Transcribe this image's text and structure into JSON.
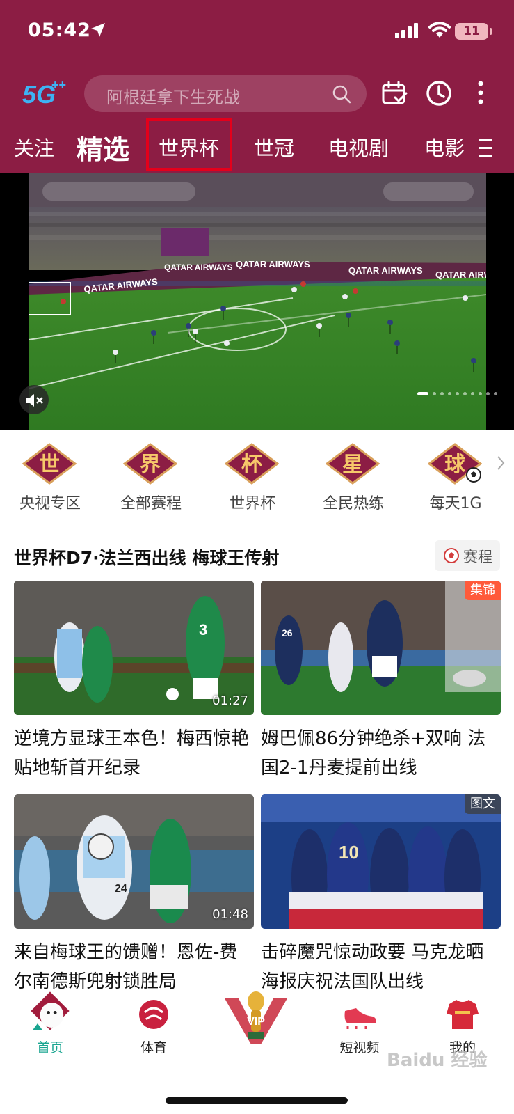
{
  "status_bar": {
    "time": "05:42",
    "battery": "11"
  },
  "header": {
    "logo_text": "5G",
    "search_placeholder": "阿根廷拿下生死战",
    "tabs": [
      {
        "label": "关注"
      },
      {
        "label": "精选",
        "active": true
      },
      {
        "label": "世界杯",
        "highlighted": true
      },
      {
        "label": "世冠"
      },
      {
        "label": "电视剧"
      },
      {
        "label": "电影"
      }
    ]
  },
  "hero": {
    "banners": [
      "QATAR AIRWAYS",
      "QATAR AIRWAYS",
      "QATAR AIRWAYS",
      "QATAR AIRWAYS",
      "QATAR AIRWAYS"
    ],
    "page_count": 10,
    "active_page": 1
  },
  "quick_links": [
    {
      "glyph": "世",
      "label": "央视专区"
    },
    {
      "glyph": "界",
      "label": "全部赛程"
    },
    {
      "glyph": "杯",
      "label": "世界杯"
    },
    {
      "glyph": "星",
      "label": "全民热练"
    },
    {
      "glyph": "球",
      "label": "每天1G"
    }
  ],
  "section": {
    "title": "世界杯D7·法兰西出线 梅球王传射",
    "schedule_label": "赛程"
  },
  "cards": [
    {
      "title": "逆境方显球王本色！梅西惊艳贴地斩首开纪录",
      "duration": "01:27",
      "jersey": "3"
    },
    {
      "title": "姆巴佩86分钟绝杀+双响 法国2-1丹麦提前出线",
      "badge": "集锦",
      "jersey": "26"
    },
    {
      "title": "来自梅球王的馈赠！恩佐-费尔南德斯兜射锁胜局",
      "duration": "01:48",
      "jersey": "24"
    },
    {
      "title": "击碎魔咒惊动政要 马克龙晒海报庆祝法国队出线",
      "badge": "图文",
      "jersey": "10"
    }
  ],
  "bottom_nav": [
    {
      "label": "首页",
      "active": true
    },
    {
      "label": "体育"
    },
    {
      "label": "VIP"
    },
    {
      "label": "短视频"
    },
    {
      "label": "我的"
    }
  ],
  "watermark": "Baidu 经验",
  "colors": {
    "header_bg": "#8c1d44",
    "active_nav": "#19a590",
    "highlight_box": "#e4001b"
  }
}
